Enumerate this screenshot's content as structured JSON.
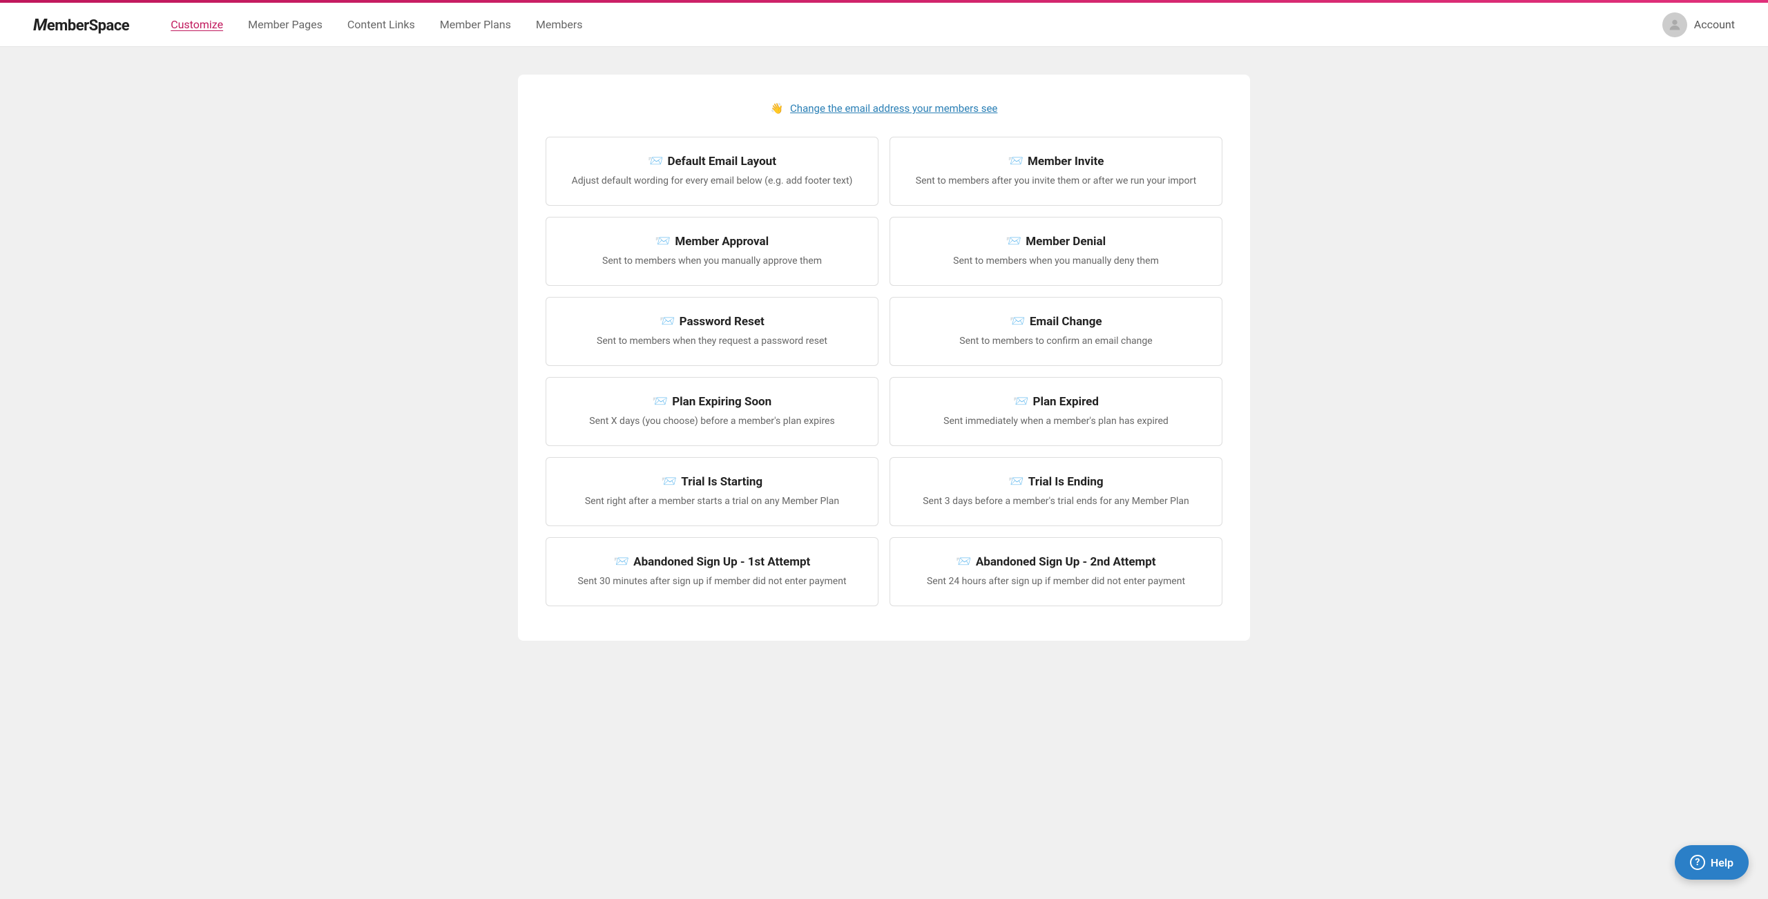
{
  "topbar": {},
  "header": {
    "logo": "MemberSpace",
    "nav": [
      {
        "label": "Customize",
        "active": true
      },
      {
        "label": "Member Pages",
        "active": false
      },
      {
        "label": "Content Links",
        "active": false
      },
      {
        "label": "Member Plans",
        "active": false
      },
      {
        "label": "Members",
        "active": false
      }
    ],
    "account_label": "Account"
  },
  "main": {
    "change_email_emoji": "👋",
    "change_email_text": "Change the email address your members see",
    "cards": [
      {
        "icon": "📧",
        "title": "Default Email Layout",
        "desc": "Adjust default wording for every email below (e.g. add footer text)"
      },
      {
        "icon": "📧",
        "title": "Member Invite",
        "desc": "Sent to members after you invite them or after we run your import"
      },
      {
        "icon": "📧",
        "title": "Member Approval",
        "desc": "Sent to members when you manually approve them"
      },
      {
        "icon": "📧",
        "title": "Member Denial",
        "desc": "Sent to members when you manually deny them"
      },
      {
        "icon": "📧",
        "title": "Password Reset",
        "desc": "Sent to members when they request a password reset"
      },
      {
        "icon": "📧",
        "title": "Email Change",
        "desc": "Sent to members to confirm an email change"
      },
      {
        "icon": "📧",
        "title": "Plan Expiring Soon",
        "desc": "Sent X days (you choose) before a member's plan expires"
      },
      {
        "icon": "📧",
        "title": "Plan Expired",
        "desc": "Sent immediately when a member's plan has expired"
      },
      {
        "icon": "📧",
        "title": "Trial Is Starting",
        "desc": "Sent right after a member starts a trial on any Member Plan"
      },
      {
        "icon": "📧",
        "title": "Trial Is Ending",
        "desc": "Sent 3 days before a member's trial ends for any Member Plan"
      },
      {
        "icon": "📧",
        "title": "Abandoned Sign Up - 1st Attempt",
        "desc": "Sent 30 minutes after sign up if member did not enter payment"
      },
      {
        "icon": "📧",
        "title": "Abandoned Sign Up - 2nd Attempt",
        "desc": "Sent 24 hours after sign up if member did not enter payment"
      }
    ],
    "help_label": "Help"
  }
}
